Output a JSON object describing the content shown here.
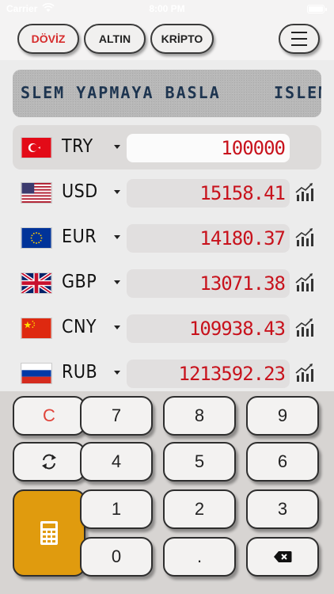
{
  "status": {
    "carrier": "Carrier",
    "time": "8:00 PM"
  },
  "tabs": [
    {
      "label": "DÖVİZ",
      "active": true
    },
    {
      "label": "ALTIN",
      "active": false
    },
    {
      "label": "KRİPTO",
      "active": false
    }
  ],
  "ticker": {
    "text": "SLEM YAPMAYA BASLA",
    "text2": "ISLEM"
  },
  "rows": [
    {
      "code": "TRY",
      "value": "100000",
      "flag": "tr"
    },
    {
      "code": "USD",
      "value": "15158.41",
      "flag": "us"
    },
    {
      "code": "EUR",
      "value": "14180.37",
      "flag": "eu"
    },
    {
      "code": "GBP",
      "value": "13071.38",
      "flag": "gb"
    },
    {
      "code": "CNY",
      "value": "109938.43",
      "flag": "cn"
    },
    {
      "code": "RUB",
      "value": "1213592.23",
      "flag": "ru"
    }
  ],
  "keypad": {
    "clear": "C",
    "seven": "7",
    "eight": "8",
    "nine": "9",
    "four": "4",
    "five": "5",
    "six": "6",
    "one": "1",
    "two": "2",
    "three": "3",
    "zero": "0",
    "dot": "."
  },
  "colors": {
    "accent": "#d62b2b",
    "value_red": "#c8121c",
    "calc_orange": "#e09b0e"
  }
}
